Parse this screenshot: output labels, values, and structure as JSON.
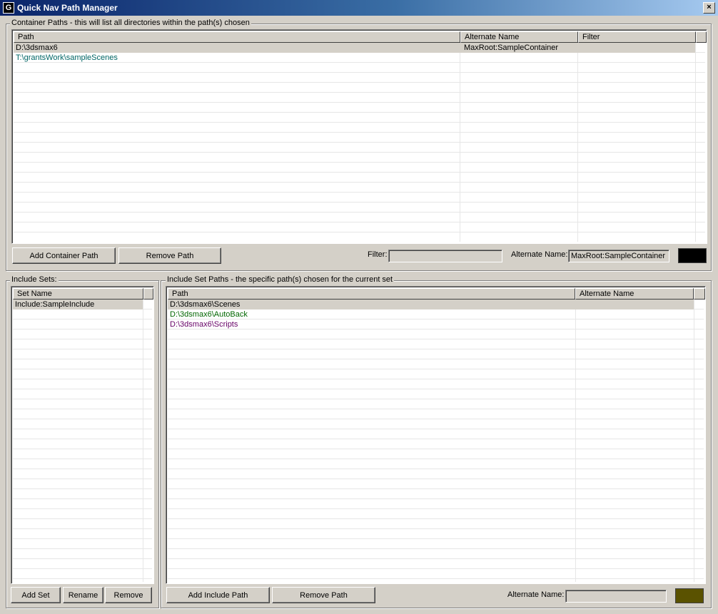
{
  "window": {
    "title": "Quick Nav Path Manager",
    "close_glyph": "×",
    "icon": "app-icon",
    "app_icon_glyph": "G"
  },
  "container_paths": {
    "legend": "Container Paths - this will list all directories within the path(s) chosen",
    "columns": [
      "Path",
      "Alternate Name",
      "Filter"
    ],
    "rows": [
      {
        "path": "D:\\3dsmax6",
        "alt_name": "MaxRoot:SampleContainer",
        "filter": "",
        "color": "#000000",
        "selected": true
      },
      {
        "path": "T:\\grantsWork\\sampleScenes",
        "alt_name": "",
        "filter": "",
        "color": "#006666",
        "selected": false
      }
    ],
    "add_button": "Add Container Path",
    "remove_button": "Remove Path",
    "filter_label": "Filter:",
    "filter_value": "",
    "alt_label": "Alternate Name:",
    "alt_value": "MaxRoot:SampleContainer",
    "swatch_color": "#000000"
  },
  "include_sets": {
    "legend": "Include Sets:",
    "columns": [
      "Set Name"
    ],
    "rows": [
      {
        "name": "Include:SampleInclude",
        "selected": true
      }
    ],
    "add_button": "Add Set",
    "rename_button": "Rename",
    "remove_button": "Remove"
  },
  "include_paths": {
    "legend": "Include Set Paths - the specific path(s) chosen for the current set",
    "columns": [
      "Path",
      "Alternate Name"
    ],
    "rows": [
      {
        "path": "D:\\3dsmax6\\Scenes",
        "alt_name": "",
        "color": "#000000",
        "selected": true
      },
      {
        "path": "D:\\3dsmax6\\AutoBack",
        "alt_name": "",
        "color": "#006600",
        "selected": false
      },
      {
        "path": "D:\\3dsmax6\\Scripts",
        "alt_name": "",
        "color": "#660066",
        "selected": false
      }
    ],
    "add_button": "Add Include Path",
    "remove_button": "Remove Path",
    "alt_label": "Alternate Name:",
    "alt_value": "",
    "swatch_color": "#5a5200"
  }
}
